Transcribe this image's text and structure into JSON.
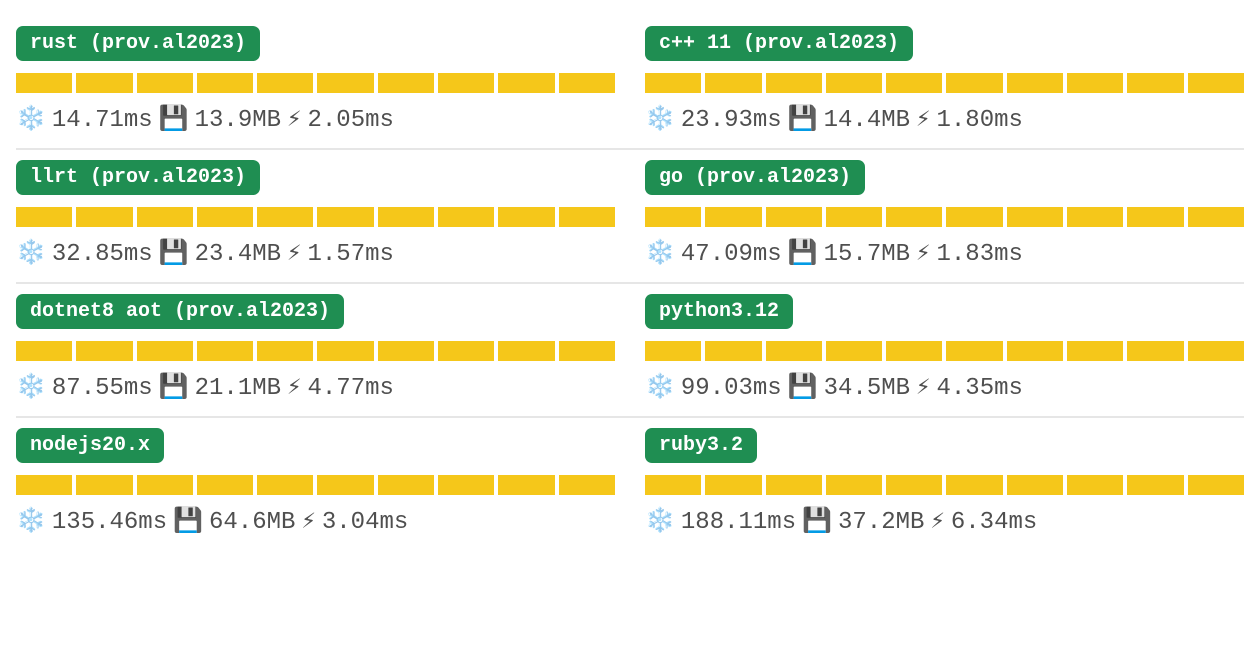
{
  "bar_count": 10,
  "icons": {
    "cold": "❄️",
    "size": "💾",
    "warm": "⚡"
  },
  "rows": [
    [
      {
        "name": "rust (prov.al2023)",
        "cold": "14.71ms",
        "size": "13.9MB",
        "warm": "2.05ms"
      },
      {
        "name": "c++ 11 (prov.al2023)",
        "cold": "23.93ms",
        "size": "14.4MB",
        "warm": "1.80ms"
      }
    ],
    [
      {
        "name": "llrt (prov.al2023)",
        "cold": "32.85ms",
        "size": "23.4MB",
        "warm": "1.57ms"
      },
      {
        "name": "go (prov.al2023)",
        "cold": "47.09ms",
        "size": "15.7MB",
        "warm": "1.83ms"
      }
    ],
    [
      {
        "name": "dotnet8 aot (prov.al2023)",
        "cold": "87.55ms",
        "size": "21.1MB",
        "warm": "4.77ms"
      },
      {
        "name": "python3.12",
        "cold": "99.03ms",
        "size": "34.5MB",
        "warm": "4.35ms"
      }
    ],
    [
      {
        "name": "nodejs20.x",
        "cold": "135.46ms",
        "size": "64.6MB",
        "warm": "3.04ms"
      },
      {
        "name": "ruby3.2",
        "cold": "188.11ms",
        "size": "37.2MB",
        "warm": "6.34ms"
      }
    ]
  ]
}
